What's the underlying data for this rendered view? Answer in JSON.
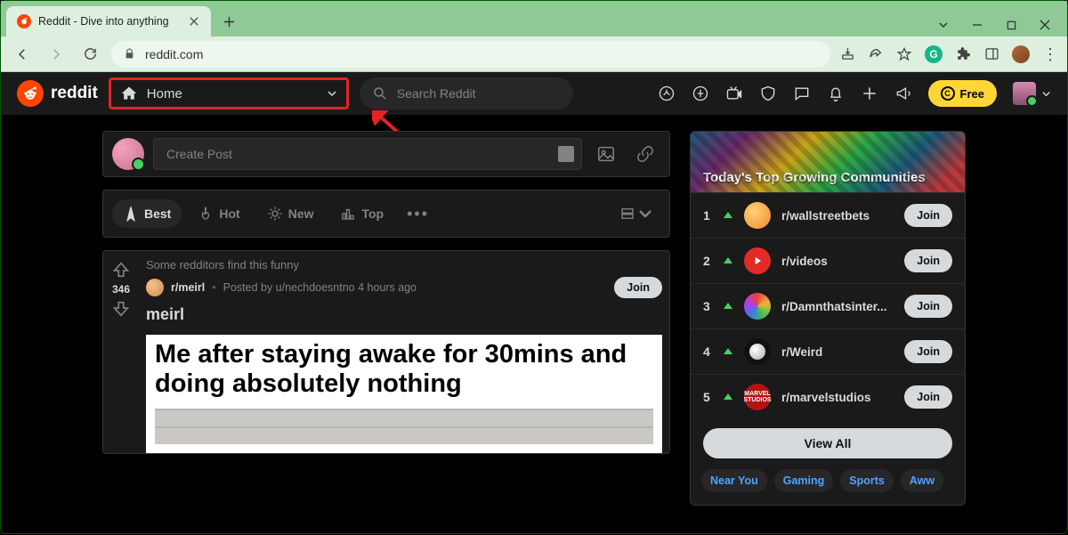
{
  "browser": {
    "tab_title": "Reddit - Dive into anything",
    "url": "reddit.com"
  },
  "header": {
    "brand": "reddit",
    "nav_selector_label": "Home",
    "search_placeholder": "Search Reddit",
    "free_label": "Free"
  },
  "create_post": {
    "placeholder": "Create Post"
  },
  "sort": {
    "best": "Best",
    "hot": "Hot",
    "new": "New",
    "top": "Top",
    "active": "best"
  },
  "post": {
    "hint": "Some redditors find this funny",
    "score": "346",
    "subreddit": "r/meirl",
    "posted_by": "Posted by u/nechdoesntno 4 hours ago",
    "join": "Join",
    "title": "meirl",
    "image_text": "Me after staying awake for 30mins and doing absolutely nothing"
  },
  "widget": {
    "title": "Today's Top Growing Communities",
    "view_all": "View All",
    "join": "Join",
    "rows": [
      {
        "rank": "1",
        "name": "r/wallstreetbets"
      },
      {
        "rank": "2",
        "name": "r/videos"
      },
      {
        "rank": "3",
        "name": "r/Damnthatsinter..."
      },
      {
        "rank": "4",
        "name": "r/Weird"
      },
      {
        "rank": "5",
        "name": "r/marvelstudios"
      }
    ],
    "chips": [
      "Near You",
      "Gaming",
      "Sports",
      "Aww"
    ]
  }
}
